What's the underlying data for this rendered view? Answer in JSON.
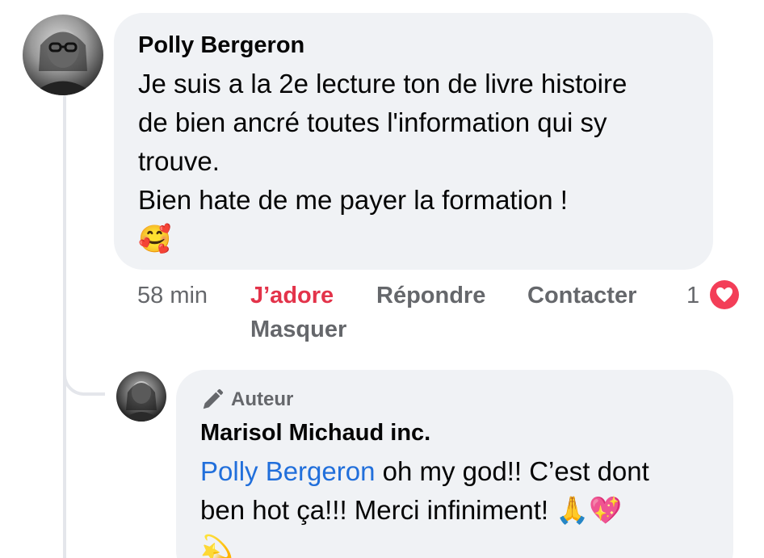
{
  "comment": {
    "author": "Polly Bergeron",
    "lines": [
      "Je suis a la 2e lecture ton de livre histoire",
      "de bien ancré toutes l'information qui sy",
      "trouve.",
      "Bien hate de me payer la formation !"
    ],
    "emoji": "🥰",
    "actions": {
      "time": "58 min",
      "love": "J’adore",
      "reply": "Répondre",
      "contact": "Contacter",
      "hide": "Masquer",
      "reaction_count": "1"
    },
    "reaction_icon": "heart-icon"
  },
  "reply": {
    "badge_icon": "pencil-icon",
    "badge": "Auteur",
    "author": "Marisol Michaud inc.",
    "mention": "Polly Bergeron",
    "text_line1": " oh my god!! C’est dont",
    "text_line2": "ben hot ça!!! Merci infiniment! ",
    "emojis": "🙏💖",
    "emoji_line3": "💫"
  },
  "colors": {
    "bubble": "#f0f2f5",
    "love": "#e3334a",
    "heart": "#f33e58",
    "mention": "#216fdb",
    "muted": "#65676b"
  }
}
